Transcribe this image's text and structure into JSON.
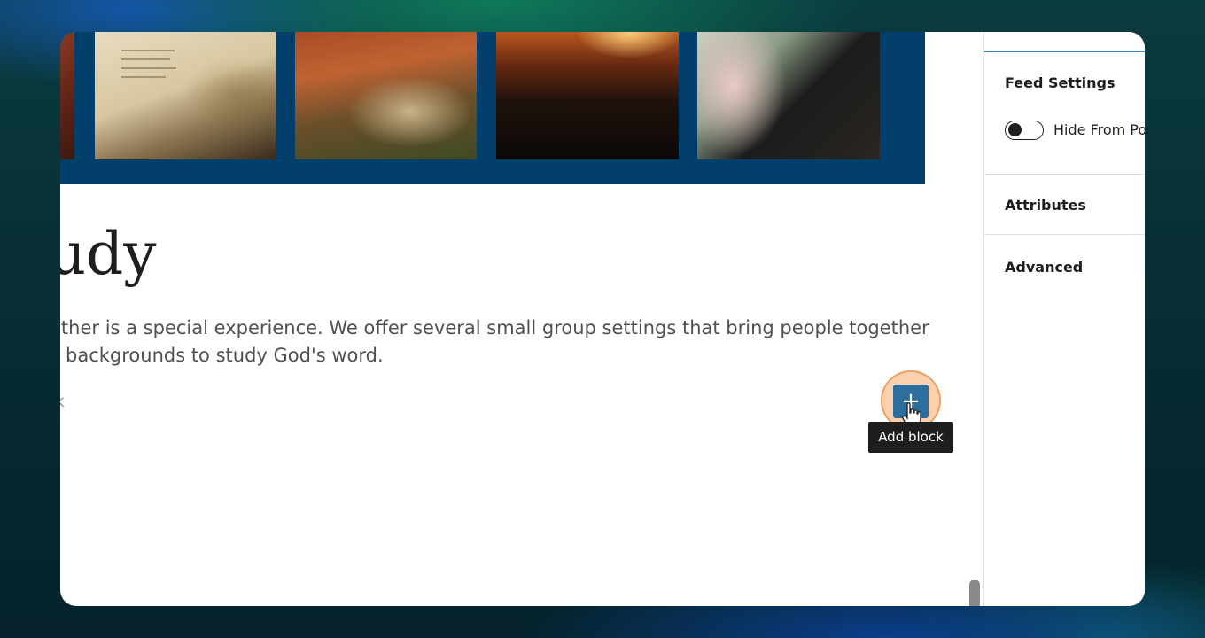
{
  "content": {
    "heading": "tudy",
    "paragraph_line_1": "ether is a special experience. We offer several small group settings that bring people together",
    "paragraph_line_2": "d backgrounds to study God's word.",
    "block_placeholder": "k"
  },
  "add_block": {
    "symbol": "+",
    "tooltip": "Add block"
  },
  "sidebar": {
    "feed_settings_title": "Feed Settings",
    "hide_toggle_label": "Hide From Po",
    "hide_toggle_on": false,
    "attributes_title": "Attributes",
    "advanced_title": "Advanced"
  },
  "icons": [
    "hand-pointer-cursor-icon",
    "plus-icon"
  ]
}
